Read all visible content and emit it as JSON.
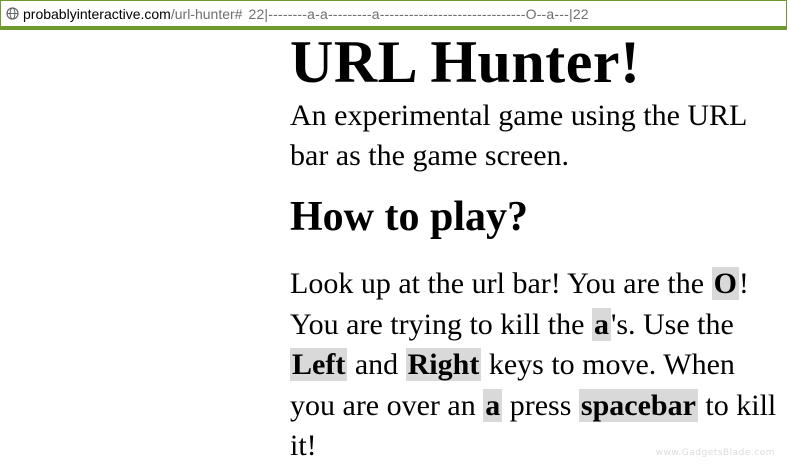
{
  "address_bar": {
    "icon": "globe-icon",
    "domain": "probablyinteractive.com",
    "path": "/url-hunter#",
    "game_state": "22|--------a-a---------a------------------------------O--a---|22",
    "border_color": "#6e9a2c"
  },
  "page": {
    "title": "URL Hunter!",
    "subtitle": "An experimental game using the URL bar as the game screen.",
    "heading": "How to play?",
    "instructions": {
      "p1": "Look up at the url bar! You are the ",
      "k1": "O",
      "p2": "! You are trying to kill the ",
      "k2": "a",
      "p3": "'s. Use the ",
      "k3": "Left",
      "p4": " and ",
      "k4": "Right",
      "p5": " keys to move. When you are over an ",
      "k5": "a",
      "p6": " press ",
      "k6": "spacebar",
      "p7": " to kill it!"
    },
    "keyword_highlight_color": "#d9d9d9"
  },
  "watermark": "www.GadgetsBlade.com"
}
